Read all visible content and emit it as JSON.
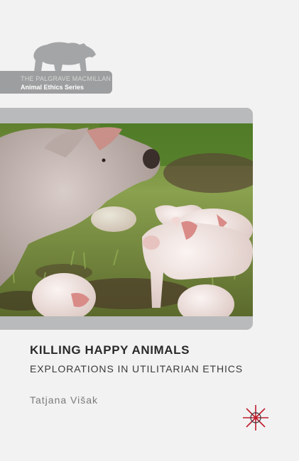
{
  "series": {
    "line1": "THE PALGRAVE MACMILLAN",
    "line2": "Animal Ethics Series",
    "logo_icon": "bear-icon"
  },
  "photo": {
    "subject": "pigs-photo",
    "colors": {
      "pig": "#e8d9d4",
      "grass": "#6f8a3c",
      "earth": "#4b3b2a"
    }
  },
  "book": {
    "title": "KILLING HAPPY ANIMALS",
    "subtitle": "EXPLORATIONS IN UTILITARIAN ETHICS",
    "author": "Tatjana Višak"
  },
  "publisher": {
    "logo_icon": "palgrave-star-icon"
  },
  "colors": {
    "background": "#f2f2f3",
    "band": "#9d9e9f",
    "frame": "#b9babb",
    "title": "#2a2a2a"
  }
}
